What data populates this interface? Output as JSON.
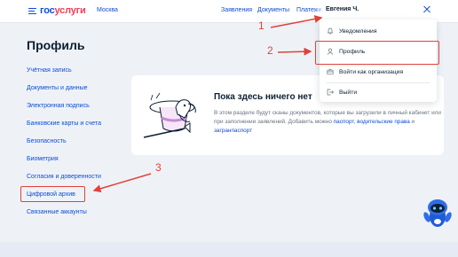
{
  "header": {
    "logo_part1": "гос",
    "logo_part2": "услуги",
    "city": "Москва",
    "nav": [
      "Заявления",
      "Документы",
      "Платежи"
    ],
    "user_name": "Евгения Ч."
  },
  "page": {
    "title": "Профиль"
  },
  "sidebar": {
    "items": [
      {
        "label": "Учётная запись"
      },
      {
        "label": "Документы и данные"
      },
      {
        "label": "Электронная подпись"
      },
      {
        "label": "Банковские карты и счета"
      },
      {
        "label": "Безопасность"
      },
      {
        "label": "Биометрия"
      },
      {
        "label": "Согласия и доверенности"
      },
      {
        "label": "Цифровой архив"
      },
      {
        "label": "Связанные аккаунты"
      }
    ]
  },
  "empty_state": {
    "title": "Пока здесь ничего нет",
    "text": "В этом разделе будут сканы документов, которые вы загрузили в личный кабинет или при заполнении заявлений. Добавить можно",
    "link1": "паспорт",
    "text2": ",",
    "link2": "водительские права",
    "text3": " и ",
    "link3": "загранпаспорт"
  },
  "dropdown": {
    "items": [
      {
        "label": "Уведомления",
        "icon": "bell-icon"
      },
      {
        "label": "Профиль",
        "icon": "user-icon"
      },
      {
        "label": "Войти как организация",
        "icon": "briefcase-icon"
      },
      {
        "label": "Выйти",
        "icon": "logout-icon"
      }
    ]
  },
  "annotations": {
    "labels": [
      "1",
      "2",
      "3"
    ],
    "color": "#e0423a"
  },
  "colors": {
    "brand_blue": "#0d4cd3",
    "brand_red": "#ee3f58",
    "background": "#eef2f7",
    "text_dark": "#0b1f33",
    "text_muted": "#66727f"
  }
}
